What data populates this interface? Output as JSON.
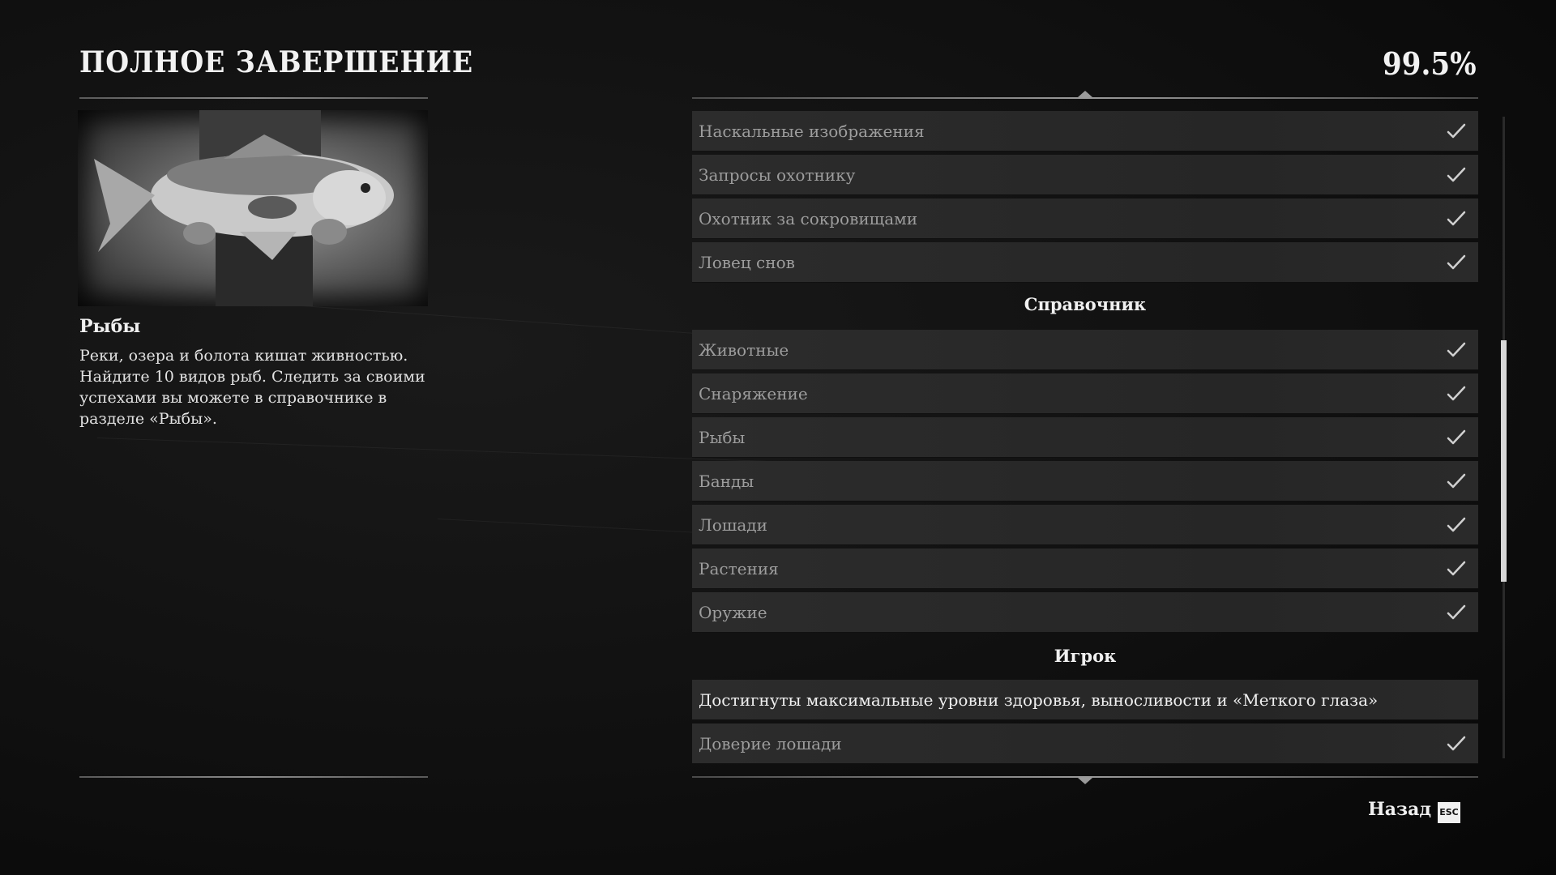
{
  "header": {
    "title": "ПОЛНОЕ ЗАВЕРШЕНИЕ",
    "percent": "99.5%"
  },
  "detail": {
    "name": "Рыбы",
    "description": "Реки, озера и болота кишат живностью. Найдите 10 видов рыб. Следить за своими успехами вы можете в справочнике в разделе «Рыбы»."
  },
  "list": {
    "rows_a": [
      {
        "label": "Наскальные изображения",
        "done": true
      },
      {
        "label": "Запросы охотнику",
        "done": true
      },
      {
        "label": "Охотник за сокровищами",
        "done": true
      },
      {
        "label": "Ловец снов",
        "done": true
      }
    ],
    "section_b": "Справочник",
    "rows_b": [
      {
        "label": "Животные",
        "done": true
      },
      {
        "label": "Снаряжение",
        "done": true
      },
      {
        "label": "Рыбы",
        "done": true
      },
      {
        "label": "Банды",
        "done": true
      },
      {
        "label": "Лошади",
        "done": true
      },
      {
        "label": "Растения",
        "done": true
      },
      {
        "label": "Оружие",
        "done": true
      }
    ],
    "section_c": "Игрок",
    "rows_c": [
      {
        "label": "Достигнуты максимальные уровни здоровья, выносливости и «Меткого глаза»",
        "done": false
      },
      {
        "label": "Доверие лошади",
        "done": true
      }
    ]
  },
  "footer": {
    "back_label": "Назад",
    "back_key": "ESC"
  },
  "icons": {
    "check": "check-icon",
    "scroll_up": "chevron-up-icon",
    "scroll_down": "chevron-down-icon"
  }
}
